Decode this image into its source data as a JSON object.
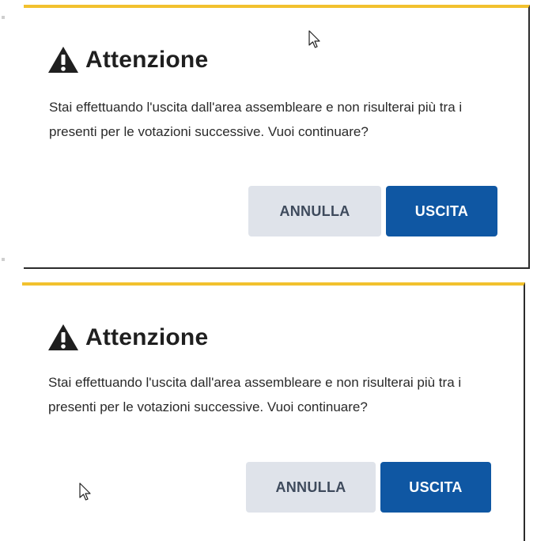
{
  "dialogs": [
    {
      "title": "Attenzione",
      "message": "Stai effettuando l'uscita dall'area assembleare e non risulterai più tra i presenti per le votazioni successive. Vuoi continuare?",
      "cancel_label": "ANNULLA",
      "confirm_label": "USCITA"
    },
    {
      "title": "Attenzione",
      "message": "Stai effettuando l'uscita dall'area assembleare e non risulterai più tra i presenti per le votazioni successive. Vuoi continuare?",
      "cancel_label": "ANNULLA",
      "confirm_label": "USCITA"
    }
  ],
  "icons": {
    "title_icon": "warning-triangle-icon",
    "pointer": "mouse-cursor-icon"
  },
  "colors": {
    "accent_top_border": "#f2c12e",
    "primary_button": "#0f57a3",
    "secondary_button": "#dfe3ea",
    "secondary_button_text": "#3e4a5c",
    "title_text": "#1f1f1f"
  }
}
